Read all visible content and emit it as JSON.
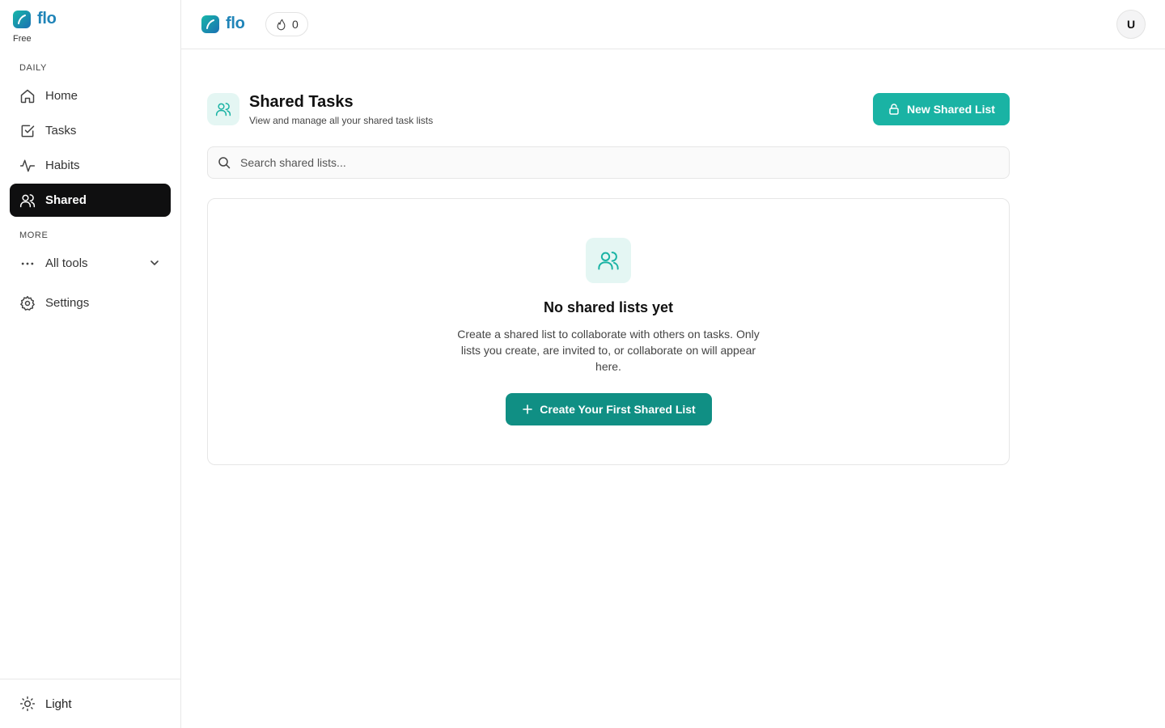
{
  "app": {
    "name": "flo",
    "plan": "Free"
  },
  "sidebar": {
    "sections": [
      {
        "label": "DAILY"
      },
      {
        "label": "MORE"
      }
    ],
    "items": [
      {
        "label": "Home",
        "icon": "home-icon"
      },
      {
        "label": "Tasks",
        "icon": "checkbox-icon"
      },
      {
        "label": "Habits",
        "icon": "activity-icon"
      },
      {
        "label": "Shared",
        "icon": "users-icon",
        "active": true
      },
      {
        "label": "All tools",
        "icon": "ellipsis-icon"
      },
      {
        "label": "Settings",
        "icon": "gear-icon"
      }
    ],
    "theme_toggle": "Light"
  },
  "topbar": {
    "brand": "flo",
    "streak_count": "0",
    "avatar_initial": "U"
  },
  "main": {
    "title": "Shared Tasks",
    "subtitle": "View and manage all your shared task lists",
    "new_button": "New Shared List",
    "search_placeholder": "Search shared lists...",
    "empty": {
      "title": "No shared lists yet",
      "description": "Create a shared list to collaborate with others on tasks. Only lists you create, are invited to, or collaborate on will appear here.",
      "button": "Create Your First Shared List"
    }
  },
  "colors": {
    "accent": "#1ab3a4",
    "accent_dark": "#108f84",
    "accent_light": "#e4f6f3",
    "active_nav": "#0f0f10",
    "brand_text": "#1f84b8"
  }
}
